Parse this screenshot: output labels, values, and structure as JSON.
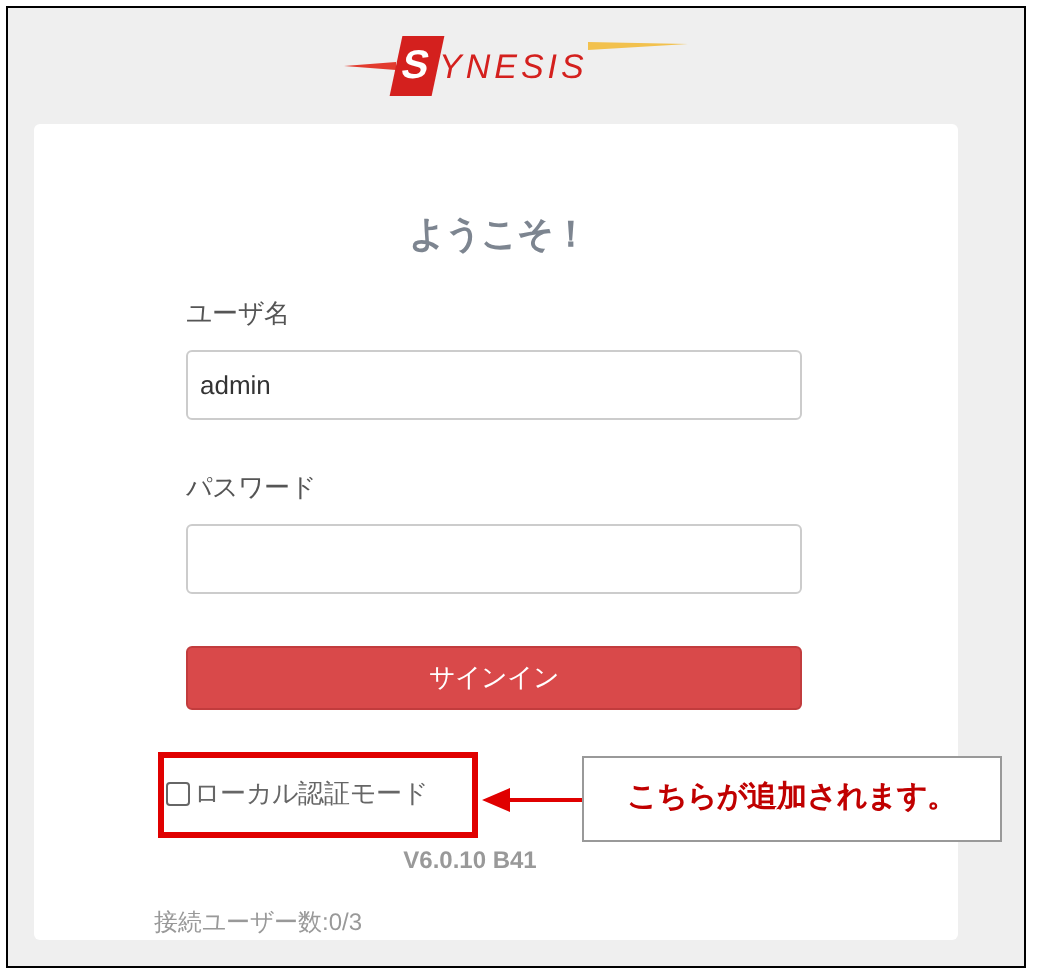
{
  "logo": {
    "text": "SYNESIS"
  },
  "login": {
    "title": "ようこそ！",
    "fields": [
      {
        "label": "ユーザ名",
        "value": "admin"
      },
      {
        "label": "パスワード"
      }
    ],
    "button": "サインイン",
    "local_auth": {
      "label": "ローカル認証モード",
      "checked": false
    },
    "version": "V6.0.10 B41",
    "connected_users": "接続ユーザー数:0/3"
  },
  "annotation": {
    "text": "こちらが追加されます。"
  }
}
